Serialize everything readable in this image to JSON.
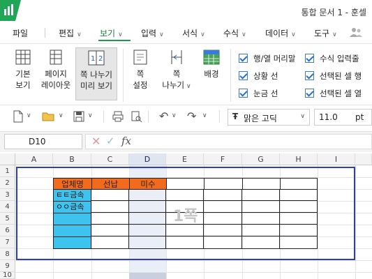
{
  "title": "통합 문서 1 - 훈셀",
  "menu": {
    "file": "파일",
    "items": [
      {
        "label": "편집",
        "active": false
      },
      {
        "label": "보기",
        "active": true
      },
      {
        "label": "입력",
        "active": false
      },
      {
        "label": "서식",
        "active": false
      },
      {
        "label": "수식",
        "active": false
      },
      {
        "label": "데이터",
        "active": false
      },
      {
        "label": "도구",
        "active": false
      }
    ]
  },
  "ribbon": {
    "normal_view": [
      "기본",
      "보기"
    ],
    "page_layout": [
      "페이지",
      "레이아웃"
    ],
    "page_break_preview": [
      "쪽 나누기",
      "미리 보기"
    ],
    "page_setup": [
      "쪽",
      "설정"
    ],
    "page_break": [
      "쪽",
      "나누기"
    ],
    "background": "배경",
    "checkboxes": [
      {
        "label": "행/열 머리말",
        "checked": true
      },
      {
        "label": "상황 선",
        "checked": true
      },
      {
        "label": "눈금 선",
        "checked": true
      },
      {
        "label": "수식 입력줄",
        "checked": true
      },
      {
        "label": "선택된 셀 행",
        "checked": true
      },
      {
        "label": "선택된 셀 열",
        "checked": true
      }
    ]
  },
  "toolbar": {
    "font_name": "맑은 고딕",
    "font_size": "11.0",
    "font_unit": "pt"
  },
  "formula_bar": {
    "cell_ref": "D10",
    "fx": "fx",
    "value": ""
  },
  "sheet": {
    "columns": [
      "A",
      "B",
      "C",
      "D",
      "E",
      "F",
      "G",
      "H",
      "I"
    ],
    "selected_column": "D",
    "rows": [
      "1",
      "2",
      "3",
      "4",
      "5",
      "6",
      "7",
      "8",
      "9",
      "10"
    ],
    "headers": [
      "업체명",
      "선납",
      "미수"
    ],
    "b3": "ㅌㅌ금속",
    "b4": "ㅇㅇ금속",
    "page_label": "1쪽",
    "colors": {
      "header_fill": "#f26a1b",
      "name_fill": "#3ec3ee",
      "print_border": "#2b3cc8"
    }
  }
}
